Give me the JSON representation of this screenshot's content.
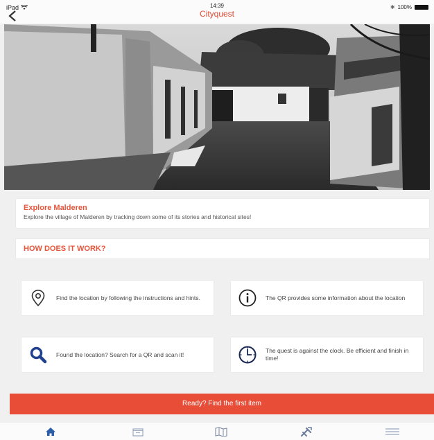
{
  "status": {
    "device": "iPad",
    "time": "14:39",
    "battery": "100%"
  },
  "app": {
    "title": "Cityquest"
  },
  "intro": {
    "title": "Explore Malderen",
    "description": "Explore the village of Malderen by tracking down some of its stories and historical sites!"
  },
  "how": {
    "title": "HOW DOES IT WORK?"
  },
  "steps": [
    {
      "icon": "location-pin-icon",
      "text": "Find the location by following the instructions and hints."
    },
    {
      "icon": "info-icon",
      "text": "The QR provides some information about the location"
    },
    {
      "icon": "search-icon",
      "text": "Found the location? Search for a QR and scan it!"
    },
    {
      "icon": "clock-icon",
      "text": "The quest is against the clock. Be efficient and finish in time!"
    }
  ],
  "cta": {
    "label": "Ready? Find the first item"
  },
  "tabs": [
    {
      "icon": "home-icon"
    },
    {
      "icon": "inbox-icon"
    },
    {
      "icon": "map-icon"
    },
    {
      "icon": "tools-icon"
    },
    {
      "icon": "menu-icon"
    }
  ],
  "colors": {
    "accent": "#e8553b",
    "cta": "#e84d38",
    "icon_blue": "#1f3f8f"
  }
}
